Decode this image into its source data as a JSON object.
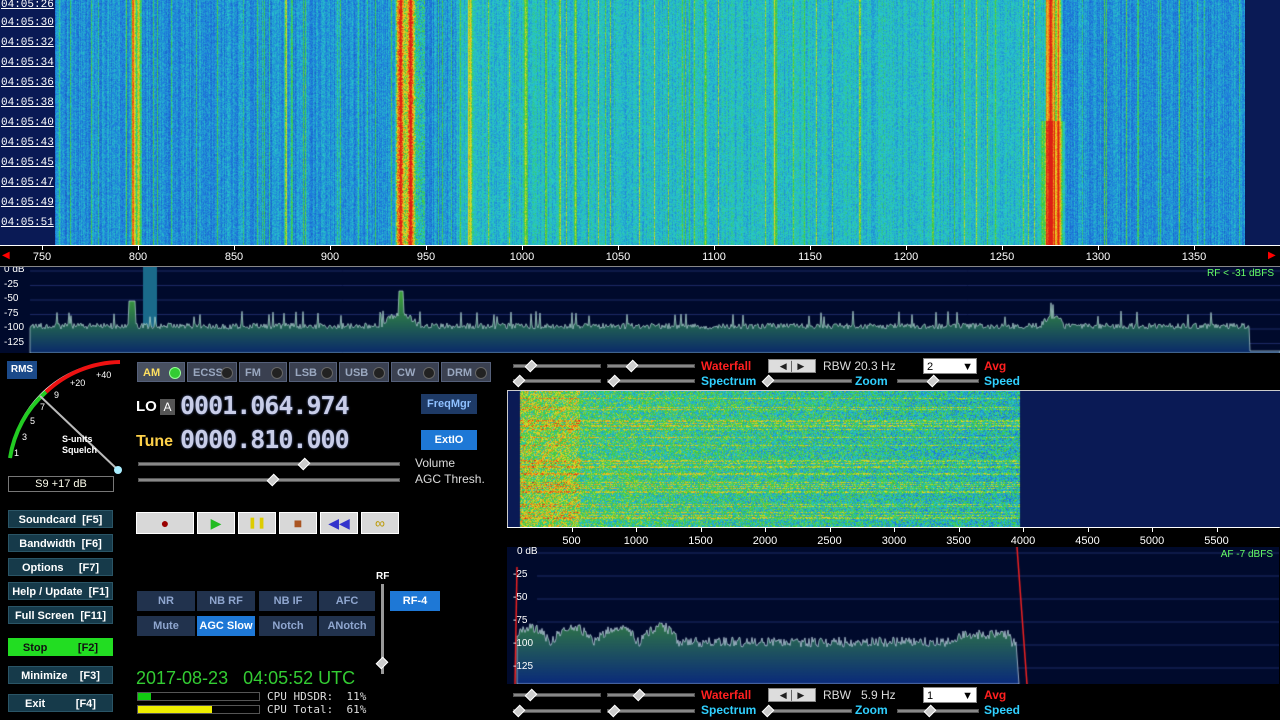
{
  "top_waterfall": {
    "timestamps": [
      "04:05:26",
      "04:05:30",
      "04:05:32",
      "04:05:34",
      "04:05:36",
      "04:05:38",
      "04:05:40",
      "04:05:43",
      "04:05:45",
      "04:05:47",
      "04:05:49",
      "04:05:51"
    ]
  },
  "freq_scale": {
    "labels": [
      "750",
      "800",
      "850",
      "900",
      "950",
      "1000",
      "1050",
      "1100",
      "1150",
      "1200",
      "1250",
      "1300",
      "1350"
    ]
  },
  "top_spectrum": {
    "db_labels": [
      "0 dB",
      "-25",
      "-50",
      "-75",
      "-100",
      "-125"
    ],
    "rf_level": "RF < -31 dBFS"
  },
  "smeter": {
    "rms_label": "RMS",
    "scale": [
      "1",
      "3",
      "5",
      "7",
      "9",
      "+20",
      "+40"
    ],
    "caption1": "S-units",
    "caption2": "Squelch",
    "reading": "S9 +17 dB"
  },
  "modes": [
    "AM",
    "ECSS",
    "FM",
    "LSB",
    "USB",
    "CW",
    "DRM"
  ],
  "lo": {
    "label": "LO",
    "badge": "A",
    "value": "0001.064.974",
    "button": "FreqMgr"
  },
  "tune": {
    "label": "Tune",
    "value": "0000.810.000",
    "button": "ExtIO"
  },
  "sliders": {
    "volume": "Volume",
    "agc": "AGC Thresh."
  },
  "transport": [
    "●",
    "▶",
    "❚❚",
    "■",
    "◀◀",
    "∞"
  ],
  "side_buttons": [
    {
      "label": "Soundcard  [F5]"
    },
    {
      "label": "Bandwidth  [F6]"
    },
    {
      "label": "Options     [F7]"
    },
    {
      "label": "Help / Update  [F1]"
    },
    {
      "label": "Full Screen  [F11]"
    },
    {
      "label": "Stop          [F2]"
    },
    {
      "label": "Minimize    [F3]"
    },
    {
      "label": "Exit          [F4]"
    }
  ],
  "dsp_row1": [
    "NR",
    "NB RF",
    "NB IF",
    "AFC"
  ],
  "dsp_row2": [
    "Mute",
    "AGC Slow",
    "Notch",
    "ANotch"
  ],
  "rf_label": "RF",
  "rf_gain": "RF-4",
  "datetime": "2017-08-23   04:05:52 UTC",
  "cpu": {
    "hdsdr": "CPU HDSDR:  11%",
    "total": "CPU Total:  61%",
    "hdsdr_pct": 11,
    "total_pct": 61
  },
  "af_top_controls": {
    "waterfall": "Waterfall",
    "rbw": "RBW  20.3 Hz",
    "avg_value": "2",
    "avg": "Avg",
    "spectrum": "Spectrum",
    "zoom": "Zoom",
    "speed": "Speed"
  },
  "af_scale": {
    "labels": [
      "500",
      "1000",
      "1500",
      "2000",
      "2500",
      "3000",
      "3500",
      "4000",
      "4500",
      "5000",
      "5500"
    ]
  },
  "af_spectrum": {
    "db_labels": [
      "0 dB",
      "-25",
      "-50",
      "-75",
      "-100",
      "-125"
    ],
    "af_level": "AF  -7 dBFS"
  },
  "af_bottom_controls": {
    "waterfall": "Waterfall",
    "rbw": "RBW   5.9 Hz",
    "avg_value": "1",
    "avg": "Avg",
    "spectrum": "Spectrum",
    "zoom": "Zoom",
    "speed": "Speed"
  },
  "colors": {
    "accent_cyan": "#30d0ff",
    "stop_green": "#22dd22",
    "tune_yellow": "#ffd24a",
    "datetime_green": "#33cc33"
  }
}
